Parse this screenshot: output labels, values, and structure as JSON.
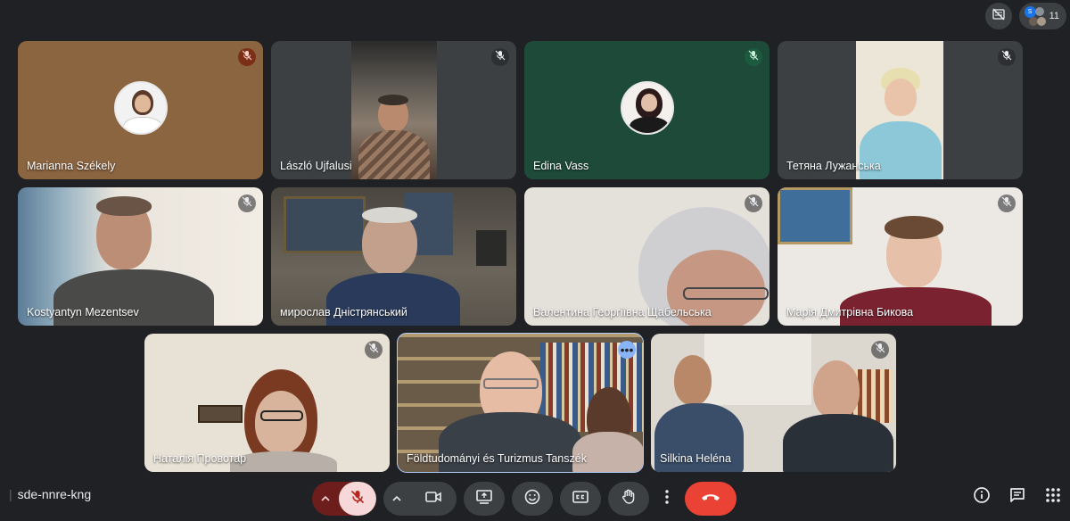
{
  "top": {
    "participant_count": "11",
    "participant_avatar_initial": "S"
  },
  "tiles": [
    {
      "name": "Marianna Székely",
      "muted_style": "red"
    },
    {
      "name": "László Ujfalusi",
      "muted_style": "plain"
    },
    {
      "name": "Edina Vass",
      "muted_style": "green"
    },
    {
      "name": "Тетяна Лужанська",
      "muted_style": "plain"
    },
    {
      "name": "Kostyantyn Mezentsev",
      "muted_style": "plain"
    },
    {
      "name": "мирослав Дністрянський",
      "muted_style": "none"
    },
    {
      "name": "Валентина Георгіївна Щабельська",
      "muted_style": "plain"
    },
    {
      "name": "Марія Дмитрівна Бикова",
      "muted_style": "plain"
    },
    {
      "name": "Наталія Провотар",
      "muted_style": "plain"
    },
    {
      "name": "Földtudományi és Turizmus Tanszék",
      "muted_style": "more"
    },
    {
      "name": "Silkina Heléna",
      "muted_style": "plain"
    }
  ],
  "bottom": {
    "meeting_code": "sde-nnre-kng",
    "icons": [
      "chevron-up-icon",
      "mic-off-icon",
      "chevron-up-icon",
      "camera-icon",
      "present-screen-icon",
      "emoji-icon",
      "captions-icon",
      "raise-hand-icon",
      "more-vert-icon",
      "end-call-icon",
      "info-icon",
      "chat-icon",
      "activities-grid-icon"
    ]
  },
  "colors": {
    "background": "#202124",
    "tile": "#3c4043",
    "end_call": "#ea4335",
    "mic_off_bg": "#f6d8d8",
    "mic_group": "#6e1d1d",
    "active_outline": "#aecbfa"
  }
}
